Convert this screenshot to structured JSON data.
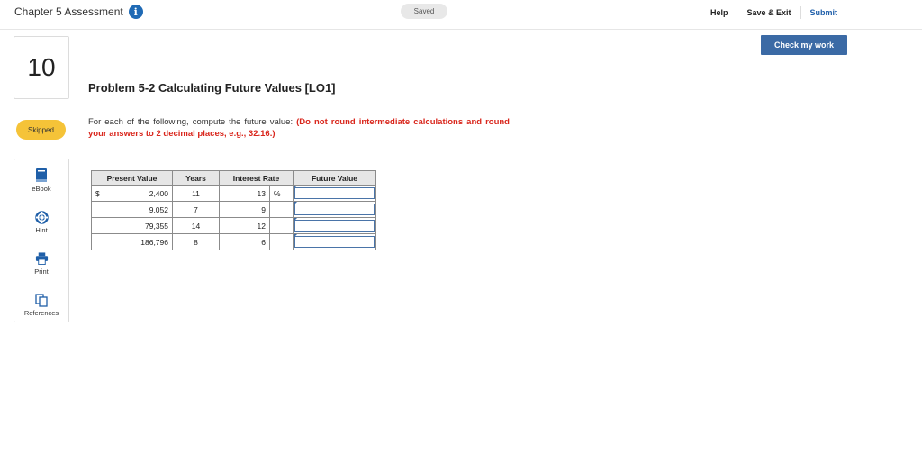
{
  "header": {
    "assessment_title": "Chapter 5 Assessment",
    "info_icon": "i",
    "status": "Saved",
    "help_label": "Help",
    "save_exit_label": "Save & Exit",
    "submit_label": "Submit",
    "check_work_label": "Check my work"
  },
  "question": {
    "number": "10",
    "status_badge": "Skipped",
    "title": "Problem 5-2 Calculating Future Values [LO1]",
    "instruction_plain": "For each of the following, compute the future value: ",
    "instruction_emphasis": "(Do not round intermediate calculations and round your answers to 2 decimal places, e.g., 32.16.)"
  },
  "tools": [
    {
      "label": "eBook",
      "icon": "book-icon"
    },
    {
      "label": "Hint",
      "icon": "lifebuoy-icon"
    },
    {
      "label": "Print",
      "icon": "printer-icon"
    },
    {
      "label": "References",
      "icon": "copy-icon"
    }
  ],
  "table": {
    "headers": [
      "Present Value",
      "Years",
      "Interest Rate",
      "Future Value"
    ],
    "currency_symbol": "$",
    "percent_symbol": "%",
    "rows": [
      {
        "present_value": "2,400",
        "years": "11",
        "rate": "13",
        "future_value": ""
      },
      {
        "present_value": "9,052",
        "years": "7",
        "rate": "9",
        "future_value": ""
      },
      {
        "present_value": "79,355",
        "years": "14",
        "rate": "12",
        "future_value": ""
      },
      {
        "present_value": "186,796",
        "years": "8",
        "rate": "6",
        "future_value": ""
      }
    ]
  },
  "colors": {
    "accent": "#3b6aa5",
    "emphasis_red": "#d9261c",
    "skipped_badge": "#f5c338"
  }
}
